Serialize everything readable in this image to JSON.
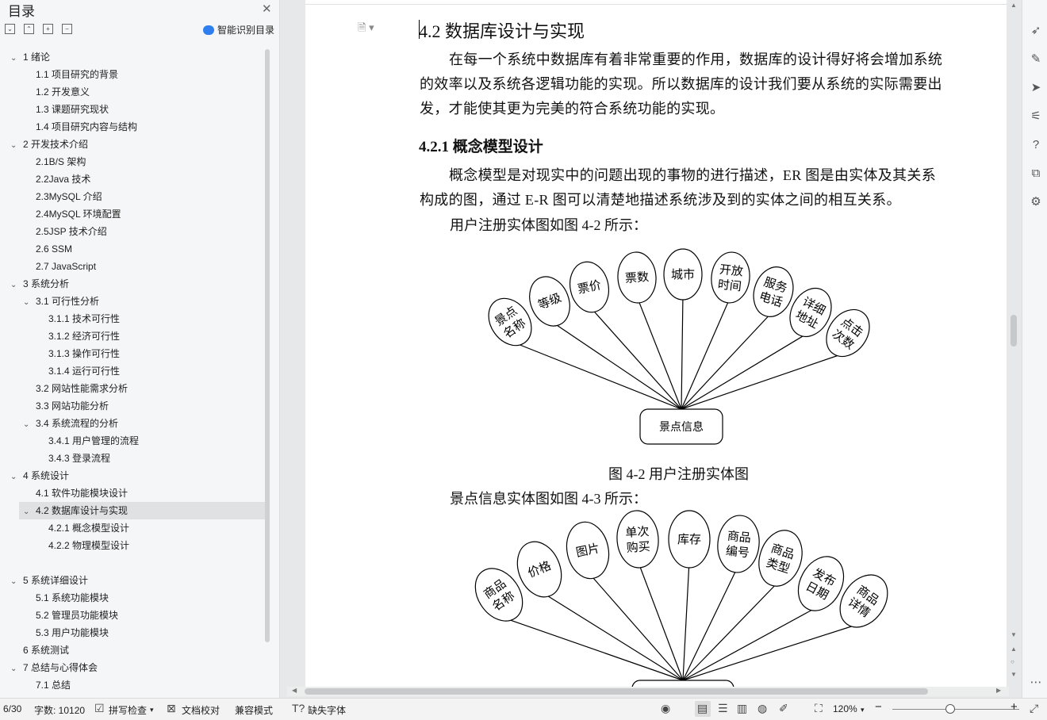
{
  "toc": {
    "title": "目录",
    "smart_toc_label": "智能识别目录",
    "items": [
      {
        "label": "1 绪论",
        "level": 0,
        "expanded": true
      },
      {
        "label": "1.1 项目研究的背景",
        "level": 1
      },
      {
        "label": "1.2 开发意义",
        "level": 1
      },
      {
        "label": "1.3 课题研究现状",
        "level": 1
      },
      {
        "label": "1.4 项目研究内容与结构",
        "level": 1
      },
      {
        "label": "2 开发技术介绍",
        "level": 0,
        "expanded": true
      },
      {
        "label": "2.1B/S 架构",
        "level": 1
      },
      {
        "label": "2.2Java 技术",
        "level": 1
      },
      {
        "label": "2.3MySQL  介绍",
        "level": 1
      },
      {
        "label": "2.4MySQL 环境配置",
        "level": 1
      },
      {
        "label": "2.5JSP 技术介绍",
        "level": 1
      },
      {
        "label": "2.6 SSM",
        "level": 1
      },
      {
        "label": "2.7 JavaScript",
        "level": 1
      },
      {
        "label": "3 系统分析",
        "level": 0,
        "expanded": true
      },
      {
        "label": "3.1 可行性分析",
        "level": 1,
        "expanded": true
      },
      {
        "label": "3.1.1 技术可行性",
        "level": 2
      },
      {
        "label": "3.1.2 经济可行性",
        "level": 2
      },
      {
        "label": "3.1.3 操作可行性",
        "level": 2
      },
      {
        "label": "3.1.4  运行可行性",
        "level": 2
      },
      {
        "label": "3.2 网站性能需求分析",
        "level": 1
      },
      {
        "label": "3.3 网站功能分析",
        "level": 1
      },
      {
        "label": "3.4 系统流程的分析",
        "level": 1,
        "expanded": true
      },
      {
        "label": "3.4.1 用户管理的流程",
        "level": 2
      },
      {
        "label": "3.4.3 登录流程",
        "level": 2
      },
      {
        "label": "4 系统设计",
        "level": 0,
        "expanded": true
      },
      {
        "label": "4.1 软件功能模块设计",
        "level": 1
      },
      {
        "label": "4.2 数据库设计与实现",
        "level": 1,
        "expanded": true,
        "selected": true
      },
      {
        "label": "4.2.1 概念模型设计",
        "level": 2
      },
      {
        "label": "4.2.2 物理模型设计",
        "level": 2
      },
      {
        "label": "",
        "level": 2
      },
      {
        "label": "5 系统详细设计",
        "level": 0,
        "expanded": true
      },
      {
        "label": "5.1 系统功能模块",
        "level": 1
      },
      {
        "label": "5.2 管理员功能模块",
        "level": 1
      },
      {
        "label": "5.3 用户功能模块",
        "level": 1
      },
      {
        "label": "6 系统测试",
        "level": 0
      },
      {
        "label": "7 总结与心得体会",
        "level": 0,
        "expanded": true
      },
      {
        "label": "7.1 总结",
        "level": 1
      }
    ]
  },
  "doc": {
    "heading": "4.2 数据库设计与实现",
    "para1": "在每一个系统中数据库有着非常重要的作用，数据库的设计得好将会增加系统的效率以及系统各逻辑功能的实现。所以数据库的设计我们要从系统的实际需要出发，才能使其更为完美的符合系统功能的实现。",
    "subheading": "4.2.1 概念模型设计",
    "para2": "概念模型是对现实中的问题出现的事物的进行描述，ER 图是由实体及其关系构成的图，通过 E-R 图可以清楚地描述系统涉及到的实体之间的相互关系。",
    "fig1_intro": "用户注册实体图如图 4-2 所示：",
    "fig1_caption": "图 4-2 用户注册实体图",
    "fig2_intro": "景点信息实体图如图 4-3 所示："
  },
  "er1": {
    "entity": "景点信息",
    "attributes": [
      [
        "景点",
        "名称"
      ],
      [
        "等级"
      ],
      [
        "票价"
      ],
      [
        "票数"
      ],
      [
        "城市"
      ],
      [
        "开放",
        "时间"
      ],
      [
        "服务",
        "电话"
      ],
      [
        "详细",
        "地址"
      ],
      [
        "点击",
        "次数"
      ]
    ]
  },
  "er2": {
    "attributes": [
      [
        "商品",
        "名称"
      ],
      [
        "价格"
      ],
      [
        "图片"
      ],
      [
        "单次",
        "购买"
      ],
      [
        "库存"
      ],
      [
        "商品",
        "编号"
      ],
      [
        "商品",
        "类型"
      ],
      [
        "发布",
        "日期"
      ],
      [
        "商品",
        "详情"
      ]
    ]
  },
  "status": {
    "page": "6/30",
    "word_count": "字数: 10120",
    "spell_check": "拼写检查",
    "doc_proof": "文档校对",
    "compat_mode": "兼容模式",
    "missing_fonts": "缺失字体",
    "zoom": "120%"
  },
  "icons": {
    "accent": "#2f7ef0"
  }
}
